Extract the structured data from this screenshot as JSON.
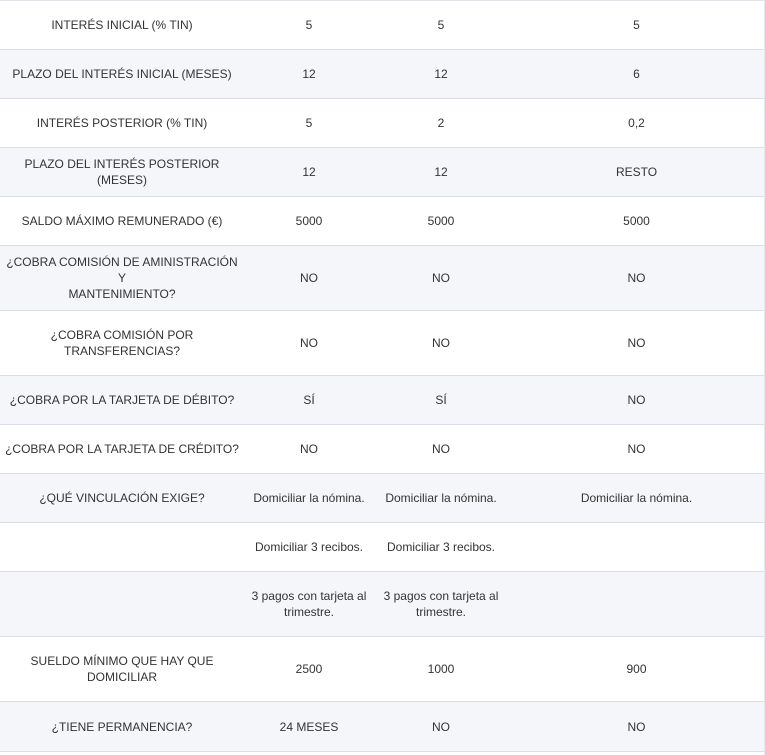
{
  "rows": [
    {
      "label": "INTERÉS INICIAL (% TIN)",
      "v1": "5",
      "v2": "5",
      "v3": "5"
    },
    {
      "label": "PLAZO DEL INTERÉS INICIAL (MESES)",
      "v1": "12",
      "v2": "12",
      "v3": "6"
    },
    {
      "label": "INTERÉS POSTERIOR (% TIN)",
      "v1": "5",
      "v2": "2",
      "v3": "0,2"
    },
    {
      "label": "PLAZO DEL INTERÉS POSTERIOR (MESES)",
      "v1": "12",
      "v2": "12",
      "v3": "RESTO"
    },
    {
      "label": "SALDO MÁXIMO REMUNERADO (€)",
      "v1": "5000",
      "v2": "5000",
      "v3": "5000"
    },
    {
      "label": "¿COBRA COMISIÓN DE AMINISTRACIÓN Y\nMANTENIMIENTO?",
      "v1": "NO",
      "v2": "NO",
      "v3": "NO"
    },
    {
      "label": "¿COBRA COMISIÓN POR\nTRANSFERENCIAS?",
      "v1": "NO",
      "v2": "NO",
      "v3": "NO"
    },
    {
      "label": "¿COBRA POR LA TARJETA DE DÉBITO?",
      "v1": "SÍ",
      "v2": "SÍ",
      "v3": "NO"
    },
    {
      "label": "¿COBRA POR LA TARJETA DE CRÉDITO?",
      "v1": "NO",
      "v2": "NO",
      "v3": "NO"
    },
    {
      "label": "¿QUÉ VINCULACIÓN EXIGE?",
      "v1": "Domiciliar la nómina.",
      "v2": "Domiciliar la nómina.",
      "v3": "Domiciliar la nómina."
    },
    {
      "label": "",
      "v1": "Domiciliar 3 recibos.",
      "v2": "Domiciliar 3 recibos.",
      "v3": ""
    },
    {
      "label": "",
      "v1": "3 pagos con tarjeta al\ntrimestre.",
      "v2": "3 pagos con tarjeta al\ntrimestre.",
      "v3": ""
    },
    {
      "label": "SUELDO MÍNIMO QUE HAY QUE\nDOMICILIAR",
      "v1": "2500",
      "v2": "1000",
      "v3": "900"
    },
    {
      "label": "¿TIENE PERMANENCIA?",
      "v1": "24 MESES",
      "v2": "NO",
      "v3": "NO"
    }
  ]
}
